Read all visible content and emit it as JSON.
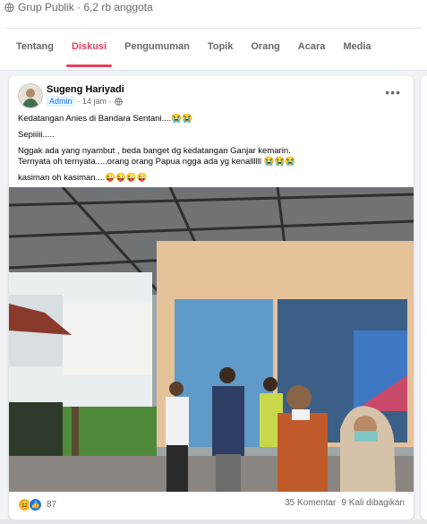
{
  "group": {
    "meta": "Grup Publik · 6,2 rb anggota",
    "tabs": [
      {
        "label": "Tentang"
      },
      {
        "label": "Diskusi"
      },
      {
        "label": "Pengumuman"
      },
      {
        "label": "Topik"
      },
      {
        "label": "Orang"
      },
      {
        "label": "Acara"
      },
      {
        "label": "Media"
      }
    ],
    "active_tab": "Diskusi"
  },
  "post": {
    "author": "Sugeng Hariyadi",
    "badge": "Admin",
    "time": "· 14 jam ·",
    "lines": [
      "Kedatangan Anies di Bandara Sentani....😭😭",
      "Sepiiiii.....",
      "Nggak ada yang nyambut , beda banget dg kedatangan Ganjar kemarin.",
      "Ternyata oh ternyata.....orang orang Papua ngga ada yg kenallllll 😭😭😭",
      "kasiman oh kasiman....😜😜😜😜"
    ],
    "reaction_count": "87",
    "comments": "35 Komentar",
    "shares": "9 Kali dibagikan"
  },
  "icons": {
    "globe": "globe-icon",
    "more": "more-options-icon",
    "haha": "haha-reaction-icon",
    "like": "like-reaction-icon"
  },
  "colors": {
    "accent": "#e4405f",
    "link": "#1877f2",
    "muted": "#65676b"
  }
}
